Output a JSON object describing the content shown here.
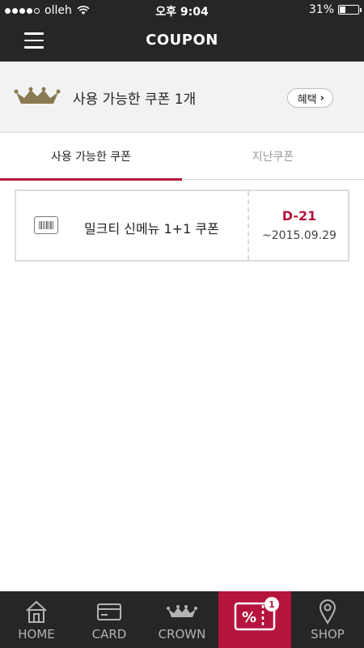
{
  "status_bar": {
    "carrier": "olleh",
    "time": "오후 9:04",
    "battery": "31%",
    "battery_level": 0.31
  },
  "header": {
    "title": "COUPON",
    "menu_icon": "hamburger-menu-icon"
  },
  "summary": {
    "icon": "crown-icon",
    "text": "사용 가능한 쿠폰 1개",
    "benefit_button": "혜택"
  },
  "tabs": [
    {
      "label": "사용 가능한 쿠폰",
      "active": true
    },
    {
      "label": "지난쿠폰",
      "active": false
    }
  ],
  "coupons": [
    {
      "icon": "barcode-icon",
      "name": "밀크티 신메뉴 1+1 쿠폰",
      "dday": "D-21",
      "expiry": "~2015.09.29"
    }
  ],
  "bottom_nav": [
    {
      "label": "HOME",
      "icon": "home-icon"
    },
    {
      "label": "CARD",
      "icon": "card-icon"
    },
    {
      "label": "CROWN",
      "icon": "crown-icon"
    },
    {
      "label": "",
      "icon": "coupon-icon",
      "badge": "1",
      "active": true
    },
    {
      "label": "SHOP",
      "icon": "location-pin-icon"
    }
  ],
  "colors": {
    "accent": "#b5143c",
    "bar_bg": "#262626",
    "crown_gold": "#8a7a52"
  }
}
